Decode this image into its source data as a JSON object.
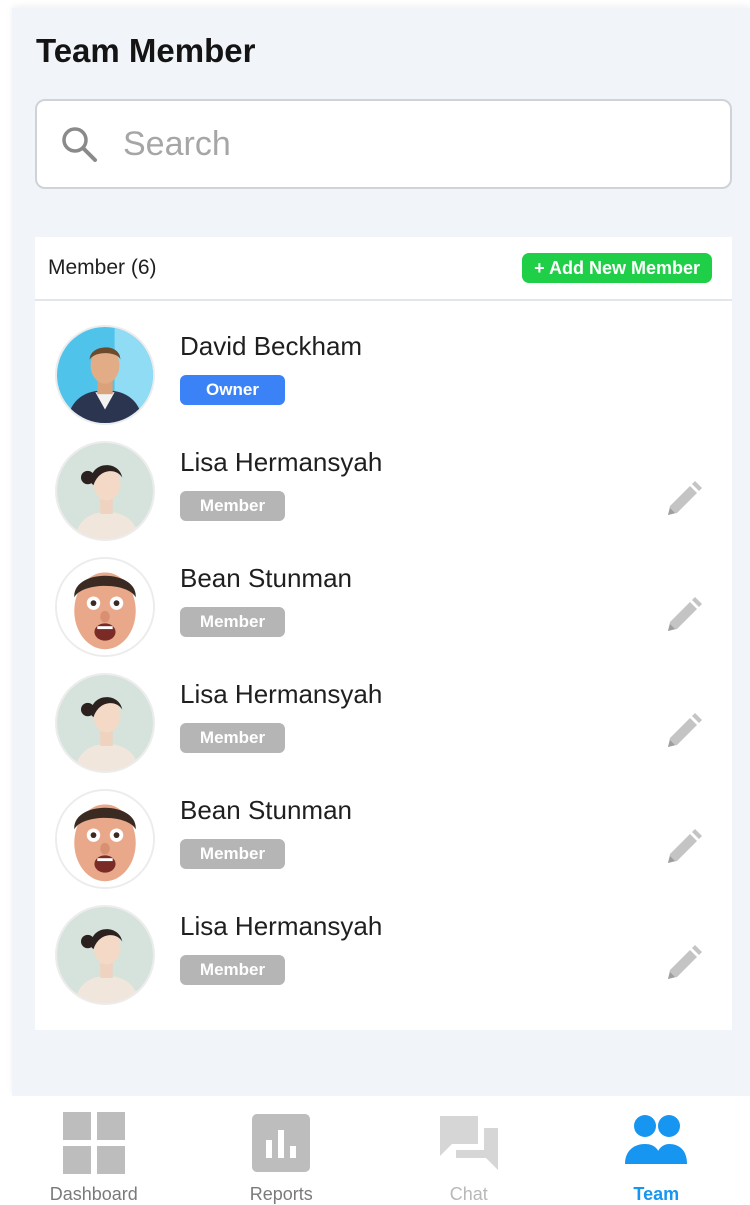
{
  "header": {
    "title": "Team Member"
  },
  "search": {
    "placeholder": "Search",
    "value": ""
  },
  "panel": {
    "member_count_label": "Member (6)",
    "add_button_label": "+ Add New Member"
  },
  "members": [
    {
      "name": "David Beckham",
      "role": "Owner",
      "avatar": "david-beckham-photo",
      "editable": false
    },
    {
      "name": "Lisa Hermansyah",
      "role": "Member",
      "avatar": "lisa-hermansyah-photo",
      "editable": true
    },
    {
      "name": "Bean Stunman",
      "role": "Member",
      "avatar": "bean-stunman-photo",
      "editable": true
    },
    {
      "name": "Lisa Hermansyah",
      "role": "Member",
      "avatar": "lisa-hermansyah-photo",
      "editable": true
    },
    {
      "name": "Bean Stunman",
      "role": "Member",
      "avatar": "bean-stunman-photo",
      "editable": true
    },
    {
      "name": "Lisa Hermansyah",
      "role": "Member",
      "avatar": "lisa-hermansyah-photo",
      "editable": true
    }
  ],
  "nav": {
    "items": [
      {
        "label": "Dashboard",
        "icon": "dashboard-icon",
        "active": false
      },
      {
        "label": "Reports",
        "icon": "reports-icon",
        "active": false
      },
      {
        "label": "Chat",
        "icon": "chat-icon",
        "active": false
      },
      {
        "label": "Team",
        "icon": "team-icon",
        "active": true
      }
    ]
  },
  "colors": {
    "owner_badge": "#3b82f6",
    "member_badge": "#b5b5b5",
    "add_button": "#1fcf48",
    "active_nav": "#1696f0",
    "inactive_nav": "#bdbdbd",
    "edit_icon": "#c4c4c4"
  }
}
